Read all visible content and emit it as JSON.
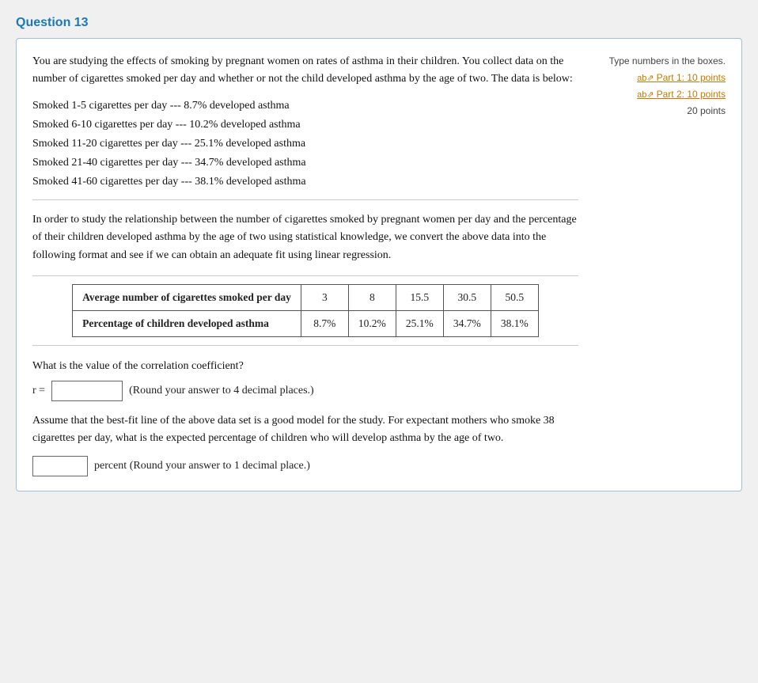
{
  "page": {
    "title": "Question 13",
    "card": {
      "sidebar": {
        "type_note": "Type numbers in the boxes.",
        "part1_label": "Part 1: 10 points",
        "part2_label": "Part 2: 10 points",
        "total_points": "20 points"
      },
      "intro": "You are studying the effects of smoking by pregnant women on rates of asthma in their children. You collect data on the number of cigarettes smoked per day and whether or not the child developed asthma by the age of two. The data is below:",
      "smoke_items": [
        "Smoked 1-5 cigarettes per day --- 8.7% developed asthma",
        "Smoked 6-10 cigarettes per day --- 10.2% developed asthma",
        "Smoked 11-20 cigarettes per day --- 25.1% developed asthma",
        "Smoked 21-40 cigarettes per day --- 34.7% developed asthma",
        "Smoked 41-60 cigarettes per day --- 38.1% developed asthma"
      ],
      "study_paragraph": "In order to study the relationship between the number of cigarettes smoked by pregnant women per day and the percentage of their children developed asthma by the age of two using statistical knowledge, we convert the above data into the following format and see if we can obtain an adequate fit using linear regression.",
      "table": {
        "row1_label": "Average number of cigarettes smoked per day",
        "row1_values": [
          "3",
          "8",
          "15.5",
          "30.5",
          "50.5"
        ],
        "row2_label": "Percentage of children developed asthma",
        "row2_values": [
          "8.7%",
          "10.2%",
          "25.1%",
          "34.7%",
          "38.1%"
        ]
      },
      "correlation_question": "What is the value of the correlation coefficient?",
      "r_label": "r =",
      "round_note": "(Round your answer to 4 decimal places.)",
      "best_fit_text": "Assume that the best-fit line of the above data set is a good model for the study. For expectant mothers who smoke 38 cigarettes per day, what is the expected percentage of children who will develop asthma by the age of two.",
      "percent_label": "percent (Round your answer to 1 decimal place.)",
      "r_input_placeholder": "",
      "percent_input_placeholder": ""
    }
  }
}
